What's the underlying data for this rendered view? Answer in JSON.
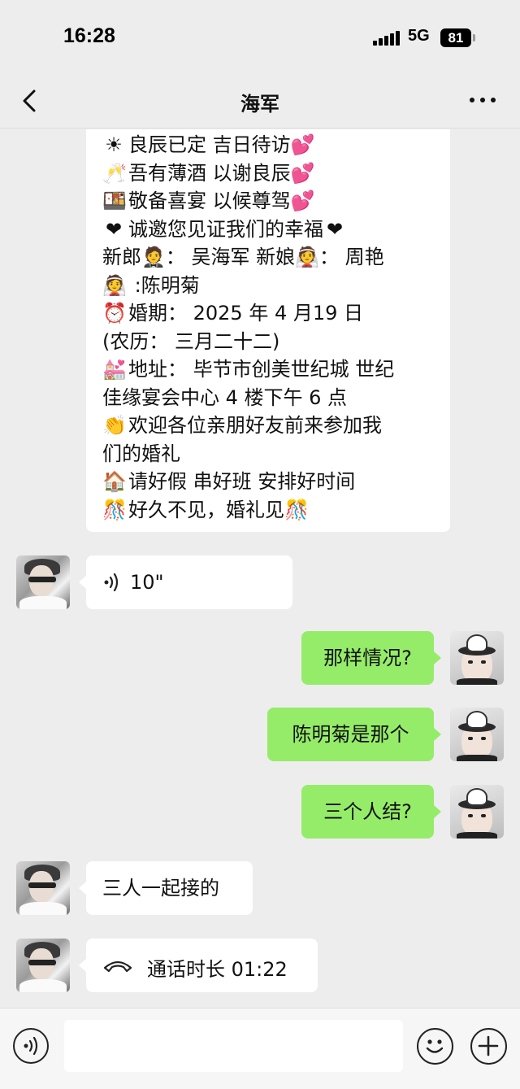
{
  "status_bar": {
    "time": "16:28",
    "network": "5G",
    "battery": "81",
    "icons": [
      "signal-icon",
      "battery-icon"
    ]
  },
  "nav": {
    "title": "海军",
    "back_icon": "chevron-left-icon",
    "more_icon": "more-dots-icon"
  },
  "invite_message": {
    "lines": [
      {
        "emoji": "☀",
        "text": "良辰已定 吉日待访",
        "suffix": "💕"
      },
      {
        "emoji": "🥂",
        "text": "吾有薄酒 以谢良辰",
        "suffix": "💕"
      },
      {
        "emoji": "🍱",
        "text": "敬备喜宴 以候尊驾",
        "suffix": "💕"
      },
      {
        "emoji": "❤",
        "text": "诚邀您见证我们的幸福",
        "suffix": "❤"
      },
      {
        "emoji": "",
        "text": "新郎🤵：  吴海军  新娘👰：  周艳",
        "suffix": ""
      },
      {
        "emoji": "👰",
        "text": " :陈明菊",
        "suffix": ""
      },
      {
        "emoji": "⏰",
        "text": "婚期：  2025 年 4 月19 日",
        "suffix": ""
      },
      {
        "emoji": "",
        "text": "(农历：  三月二十二)",
        "suffix": ""
      },
      {
        "emoji": "💒",
        "text": "地址：  毕节市创美世纪城  世纪",
        "suffix": ""
      },
      {
        "emoji": "",
        "text": "佳缘宴会中心 4 楼下午 6 点",
        "suffix": ""
      },
      {
        "emoji": "👏",
        "text": "欢迎各位亲朋好友前来参加我",
        "suffix": ""
      },
      {
        "emoji": "",
        "text": "们的婚礼",
        "suffix": ""
      },
      {
        "emoji": "🏠",
        "text": "请好假 串好班 安排好时间",
        "suffix": ""
      },
      {
        "emoji": "🎊",
        "text": "好久不见，婚礼见",
        "suffix": "🎊"
      }
    ]
  },
  "messages": {
    "voice": {
      "duration": "10\"",
      "icon": "voice-wave-icon"
    },
    "sent_1": "那样情况?",
    "sent_2": "陈明菊是那个",
    "sent_3": "三个人结?",
    "recv_1": "三人一起接的",
    "call": {
      "label": "通话时长 01:22",
      "icon": "phone-hangup-icon"
    }
  },
  "input_bar": {
    "voice_icon": "voice-toggle-icon",
    "emoji_icon": "emoji-icon",
    "plus_icon": "plus-icon",
    "placeholder": ""
  }
}
